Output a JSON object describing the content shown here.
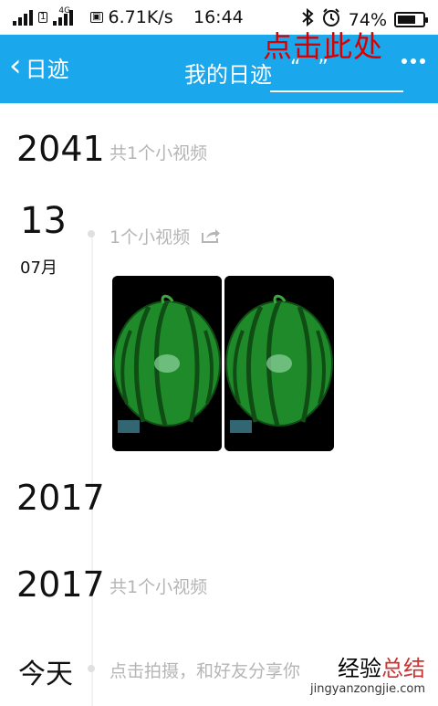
{
  "status_bar": {
    "net_type": "4G",
    "speed": "6.71K/s",
    "time": "16:44",
    "battery_percent": "74%",
    "battery_level": 0.74
  },
  "header": {
    "back_label": "日迹",
    "title": "我的日迹",
    "overlay_red_text": "点击此处",
    "overlay_quote_text": "“ ”",
    "background_color": "#1aa7ec"
  },
  "timeline": {
    "year_2041": "2041",
    "year_2041_note": "共1个小视频",
    "day": "13",
    "month": "07月",
    "day_note": "1个小视频",
    "year_2017_a": "2017",
    "year_2017_b": "2017",
    "year_2017_b_note": "共1个小视频",
    "today_label": "今天",
    "today_note": "点击拍摄，和好友分享你"
  },
  "watermark": {
    "cn_black": "经验",
    "cn_red": "总结",
    "url": "jingyanzongjie.com"
  }
}
